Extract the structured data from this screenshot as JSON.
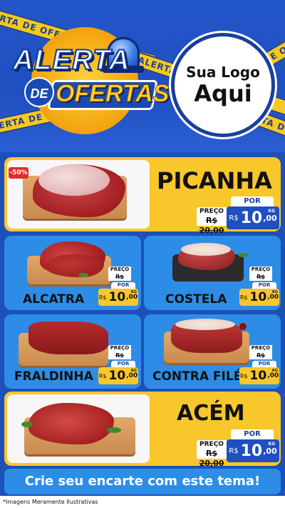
{
  "header": {
    "tape_text": "ALERTA DE OFERTA",
    "title_line1": "ALERTA",
    "title_de": "DE",
    "title_line2": "OFERTAS",
    "logo_line1": "Sua Logo",
    "logo_line2": "Aqui"
  },
  "products": [
    {
      "name": "PICANHA",
      "badge": "-50%",
      "preco_label": "PREÇO",
      "old_price": "R$ 20,00",
      "por_label": "POR",
      "currency": "R$",
      "price_int": "10",
      "price_cents": ",00",
      "unit": "KG"
    },
    {
      "name": "ALCATRA",
      "preco_label": "PREÇO",
      "old_price": "R$ 20,00",
      "por_label": "POR",
      "currency": "R$",
      "price_int": "10",
      "price_cents": ",00",
      "unit": "KG"
    },
    {
      "name": "COSTELA",
      "preco_label": "PREÇO",
      "old_price": "R$ 20,00",
      "por_label": "POR",
      "currency": "R$",
      "price_int": "10",
      "price_cents": ",00",
      "unit": "KG"
    },
    {
      "name": "FRALDINHA",
      "preco_label": "PREÇO",
      "old_price": "R$ 20,00",
      "por_label": "POR",
      "currency": "R$",
      "price_int": "10",
      "price_cents": ",00",
      "unit": "KG"
    },
    {
      "name": "CONTRA FILÉ",
      "preco_label": "PREÇO",
      "old_price": "R$ 20,00",
      "por_label": "POR",
      "currency": "R$",
      "price_int": "10",
      "price_cents": ",00",
      "unit": "KG"
    },
    {
      "name": "ACÉM",
      "preco_label": "PREÇO",
      "old_price": "R$ 20,00",
      "por_label": "POR",
      "currency": "R$",
      "price_int": "10",
      "price_cents": ",00",
      "unit": "KG"
    }
  ],
  "cta": "Crie seu encarte com este tema!",
  "footer_note": "*Imagens Meramente Ilustrativas",
  "colors": {
    "yellow": "#f8c72c",
    "blue": "#2d8de6",
    "dark_blue": "#1f4fc0",
    "badge_red": "#e52b2b"
  }
}
